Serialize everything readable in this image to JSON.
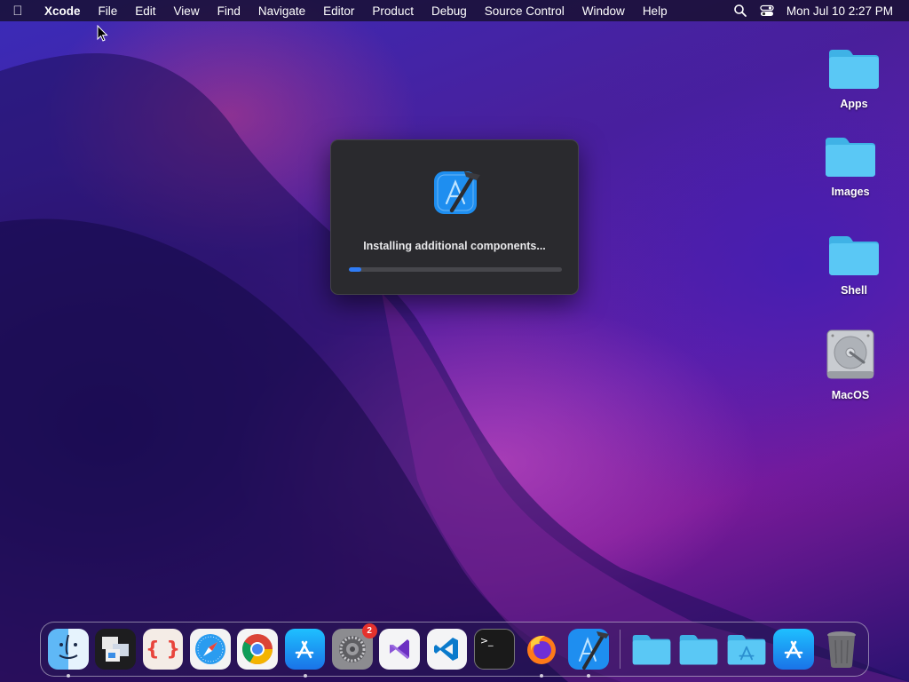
{
  "menubar": {
    "app_name": "Xcode",
    "items": [
      "File",
      "Edit",
      "View",
      "Find",
      "Navigate",
      "Editor",
      "Product",
      "Debug",
      "Source Control",
      "Window",
      "Help"
    ],
    "clock": "Mon Jul 10  2:27 PM"
  },
  "desktop": {
    "icons": [
      {
        "label": "Apps",
        "icon": "folder-icon"
      },
      {
        "label": "Images",
        "icon": "folder-icon"
      },
      {
        "label": "Shell",
        "icon": "folder-icon"
      },
      {
        "label": "MacOS",
        "icon": "hard-drive-icon"
      }
    ]
  },
  "dialog": {
    "status_text": "Installing additional components...",
    "progress": 0.06
  },
  "dock": {
    "apps": [
      {
        "name": "Finder",
        "running": true
      },
      {
        "name": "Preview",
        "running": false
      },
      {
        "name": "Script Editor",
        "running": false
      },
      {
        "name": "Safari",
        "running": false
      },
      {
        "name": "Chrome",
        "running": false
      },
      {
        "name": "App Store",
        "running": true
      },
      {
        "name": "System Settings",
        "running": false,
        "badge": "2"
      },
      {
        "name": "Visual Studio",
        "running": false
      },
      {
        "name": "VS Code",
        "running": false
      },
      {
        "name": "Terminal",
        "running": false
      },
      {
        "name": "Firefox",
        "running": true
      },
      {
        "name": "Xcode",
        "running": true
      }
    ],
    "folders": [
      "Folder",
      "Folder",
      "Applications",
      "App Store",
      "Trash"
    ]
  },
  "colors": {
    "accent": "#2f7cf6",
    "folder": "#5ac8f5",
    "badge": "#e5322d"
  }
}
